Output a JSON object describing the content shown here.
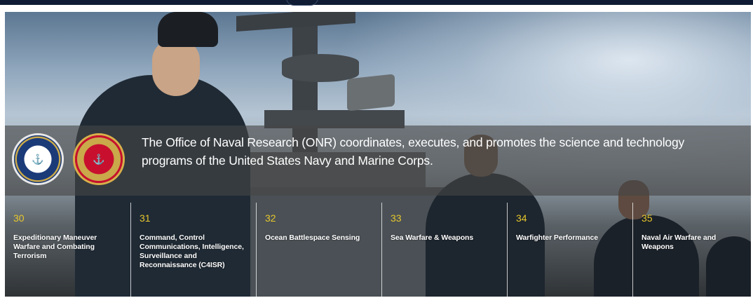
{
  "banner": {
    "tagline": "The Office of Naval Research (ONR) coordinates, executes, and promotes the science and technology programs of the United States Navy and Marine Corps."
  },
  "seals": [
    {
      "name": "department-of-the-navy-seal",
      "colors": {
        "ring": "#1b3a78",
        "trim": "#c9a94a"
      }
    },
    {
      "name": "department-of-the-navy-usmc-seal",
      "colors": {
        "ring": "#c8102e",
        "trim": "#c9a94a"
      }
    }
  ],
  "departments": [
    {
      "number": "30",
      "title": "Expeditionary Maneuver Warfare and Combating Terrorism"
    },
    {
      "number": "31",
      "title": "Command, Control Communications, Intelligence, Surveillance and Reconnaissance (C4ISR)"
    },
    {
      "number": "32",
      "title": "Ocean Battlespace Sensing"
    },
    {
      "number": "33",
      "title": "Sea Warfare & Weapons"
    },
    {
      "number": "34",
      "title": "Warfighter Performance"
    },
    {
      "number": "35",
      "title": "Naval Air Warfare and Weapons"
    }
  ],
  "colors": {
    "number_accent": "#e7c72d",
    "band_overlay": "rgba(70,70,70,0.62)",
    "topbar": "#0f1c33"
  }
}
